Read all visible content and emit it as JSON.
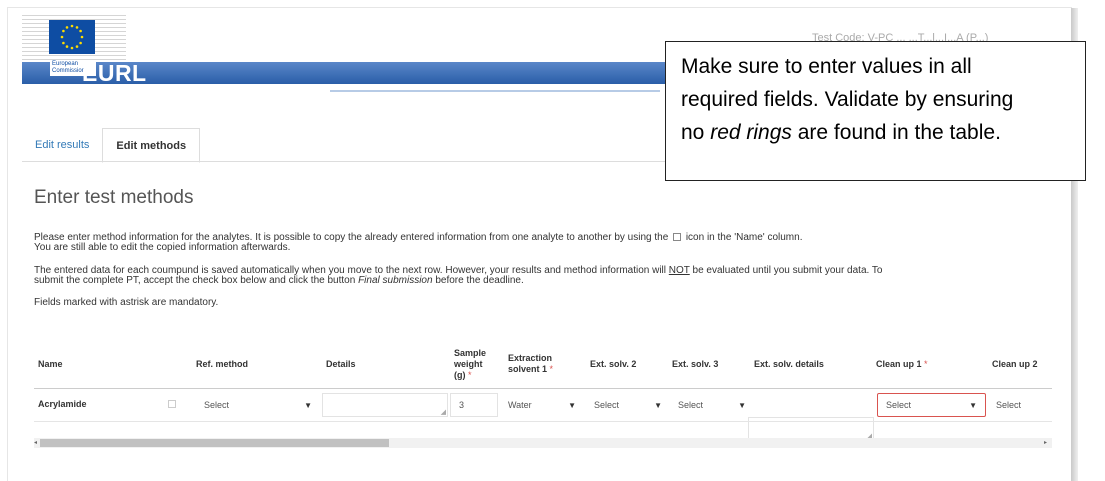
{
  "header": {
    "logo_caption": "European Commission",
    "title": "EURL",
    "top_right_text": "Test Code: V-PC ... ...T...l...I...A (P...)",
    "band_color": "#2a5ea8"
  },
  "tabs": [
    {
      "label": "Edit results",
      "active": false
    },
    {
      "label": "Edit methods",
      "active": true
    }
  ],
  "page_title": "Enter test methods",
  "instructions": {
    "p1_a": "Please enter method information for the analytes. It is possible to copy the already entered information from one analyte to another by using the",
    "p1_b": "icon in the 'Name' column.",
    "p1_line2": "You are still able to edit the copied information afterwards.",
    "p2_a": "The entered data for each coumpund is saved automatically when you move to the next row. However, your results and method information will",
    "p2_not": "NOT",
    "p2_b": "be evaluated until you submit your data. To",
    "p2_line2_a": "submit the complete PT, accept the check box below and click the button",
    "p2_line2_em": "Final submission",
    "p2_line2_b": "before the deadline.",
    "p3": "Fields marked with astrisk are mandatory."
  },
  "table": {
    "columns": [
      {
        "label": "Name",
        "required": false
      },
      {
        "label": "Ref. method",
        "required": false
      },
      {
        "label": "Details",
        "required": false
      },
      {
        "label": "Sample weight (g)",
        "required": true
      },
      {
        "label": "Extraction solvent 1",
        "required": true
      },
      {
        "label": "Ext. solv. 2",
        "required": false
      },
      {
        "label": "Ext. solv. 3",
        "required": false
      },
      {
        "label": "Ext. solv. details",
        "required": false
      },
      {
        "label": "Clean up 1",
        "required": true
      },
      {
        "label": "Clean up 2",
        "required": false
      }
    ],
    "required_marker": "*",
    "row": {
      "name": "Acrylamide",
      "ref_method": "Select",
      "details": "",
      "sample_weight": "3",
      "extraction_solvent_1": "Water",
      "ext_solv_2": "Select",
      "ext_solv_3": "Select",
      "ext_solv_details": "",
      "clean_up_1": "Select",
      "clean_up_2": "Select"
    },
    "invalid_color": "#d9534f"
  },
  "scrollbar": {
    "left_arrow": "◂",
    "right_arrow": "▸"
  },
  "callout": {
    "line1": "Make sure to enter values in all",
    "line2": "required fields. Validate by ensuring",
    "line3_a": "no",
    "line3_em": "red rings",
    "line3_b": "are found in the table."
  }
}
